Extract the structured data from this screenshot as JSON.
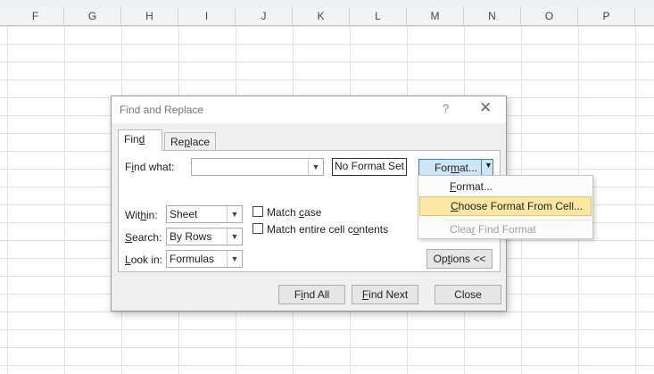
{
  "columns": [
    "F",
    "G",
    "H",
    "I",
    "J",
    "K",
    "L",
    "M",
    "N",
    "O",
    "P"
  ],
  "dialog": {
    "title": "Find and Replace",
    "help_glyph": "?",
    "close_glyph": "✕",
    "tabs": [
      {
        "pre": "Fin",
        "key": "d",
        "post": ""
      },
      {
        "pre": "Re",
        "key": "p",
        "post": "lace"
      }
    ],
    "find_what": {
      "pre": "F",
      "key": "i",
      "post": "nd what:",
      "value": ""
    },
    "no_format_set": "No Format Set",
    "format_button": {
      "pre": "For",
      "key": "m",
      "post": "at..."
    },
    "within": {
      "pre": "Wit",
      "key": "h",
      "post": "in:",
      "value": "Sheet"
    },
    "search": {
      "pre": "",
      "key": "S",
      "post": "earch:",
      "value": "By Rows"
    },
    "look_in": {
      "pre": "",
      "key": "L",
      "post": "ook in:",
      "value": "Formulas"
    },
    "match_case": {
      "pre": "Match ",
      "key": "c",
      "post": "ase",
      "checked": false
    },
    "match_entire": {
      "pre": "Match entire cell c",
      "key": "o",
      "post": "ntents",
      "checked": false
    },
    "options_button": {
      "pre": "Op",
      "key": "t",
      "post": "ions <<"
    },
    "find_all": {
      "pre": "F",
      "key": "i",
      "post": "nd All"
    },
    "find_next": {
      "pre": "",
      "key": "F",
      "post": "ind Next"
    },
    "close_button": "Close"
  },
  "format_menu": {
    "items": [
      {
        "pre": "",
        "key": "F",
        "post": "ormat...",
        "state": "normal"
      },
      {
        "pre": "",
        "key": "C",
        "post": "hoose Format From Cell...",
        "state": "highlighted"
      },
      {
        "pre": "Clea",
        "key": "r",
        "post": " Find Format",
        "state": "disabled"
      }
    ]
  },
  "colors": {
    "highlight": "#fce7a6",
    "format_button_bg": "#cde6f7",
    "dialog_bg": "#f0f0f0"
  }
}
